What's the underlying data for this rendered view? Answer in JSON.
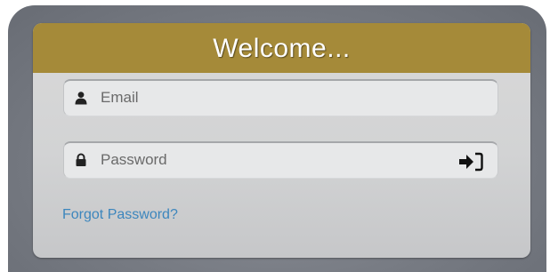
{
  "login_card": {
    "title": "Welcome...",
    "email_field": {
      "placeholder": "Email",
      "value": "",
      "icon": "user-icon"
    },
    "password_field": {
      "placeholder": "Password",
      "value": "",
      "icon": "lock-icon"
    },
    "submit_icon": "sign-in-icon",
    "forgot_password_label": "Forgot Password?"
  },
  "colors": {
    "header": "#a58a39",
    "link": "#3c86bd",
    "frame": "#7b7f87",
    "card": "#d4d5d6"
  }
}
